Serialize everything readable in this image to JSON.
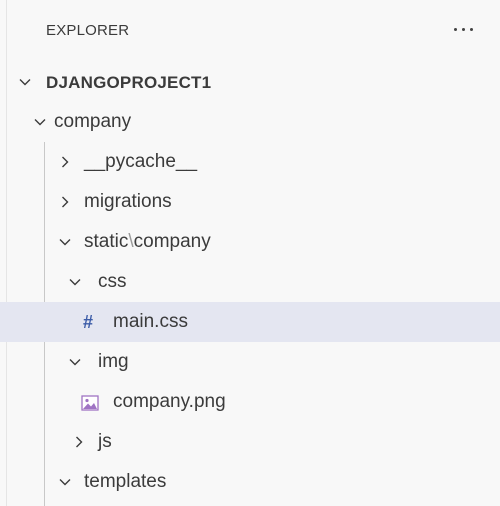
{
  "explorer": {
    "title": "EXPLORER"
  },
  "tree": {
    "root": "DJANGOPROJECT1",
    "company": "company",
    "pycache": "__pycache__",
    "migrations": "migrations",
    "static_part1": "static",
    "static_sep": "\\",
    "static_part2": "company",
    "css": "css",
    "main_css": "main.css",
    "main_css_icon_glyph": "#",
    "img": "img",
    "company_png": "company.png",
    "js": "js",
    "templates": "templates"
  },
  "icons": {
    "more": "ellipsis-icon",
    "expanded": "chevron-down-icon",
    "collapsed": "chevron-right-icon",
    "css_file": "css-file-icon",
    "image_file": "image-file-icon"
  },
  "colors": {
    "background": "#f8f8f8",
    "selected_row": "#e4e6f1",
    "css_icon": "#3c5ca8",
    "image_icon": "#a074c4"
  }
}
